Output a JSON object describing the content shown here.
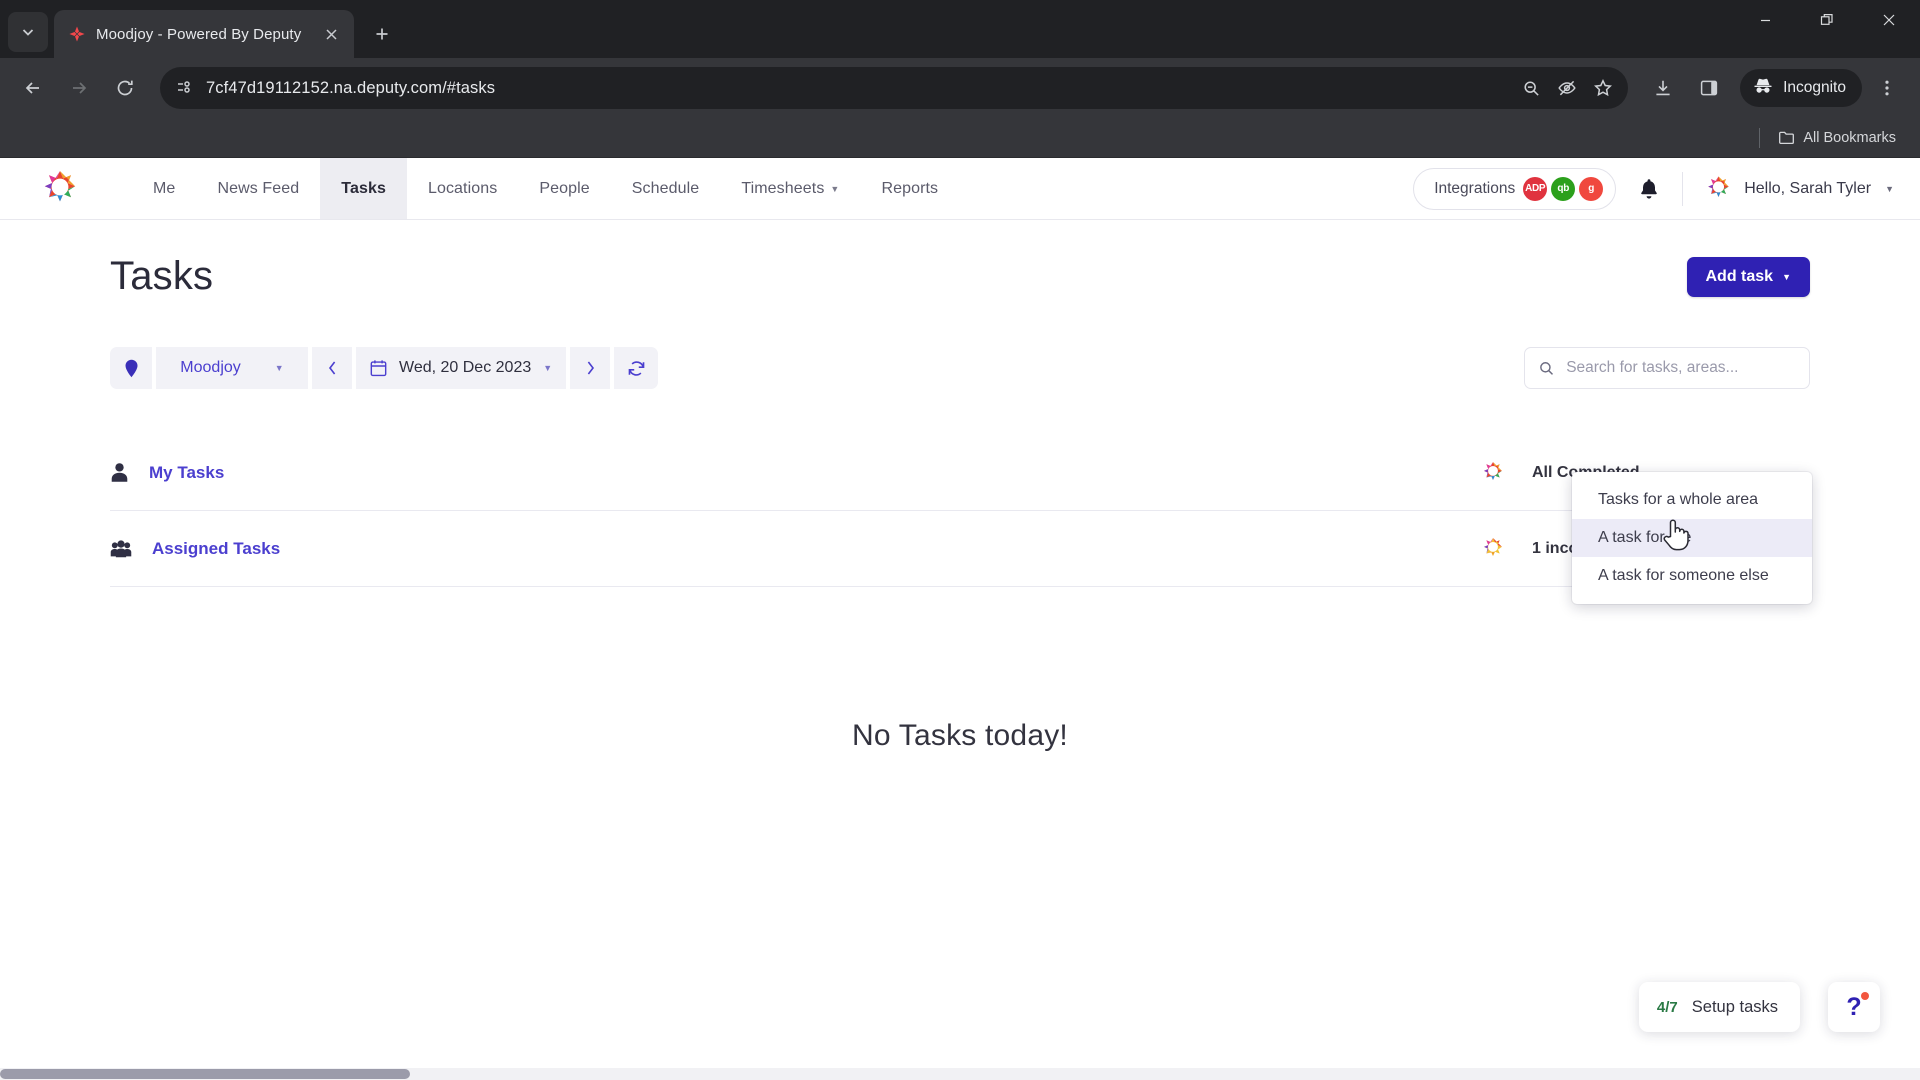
{
  "browser": {
    "tab": {
      "title": "Moodjoy - Powered By Deputy",
      "favicon_icon": "deputy-favicon",
      "close_icon": "close-icon",
      "tab_search_icon": "tab-search-chevron-icon",
      "new_tab_icon": "new-tab-plus-icon"
    },
    "window_controls": {
      "minimize_icon": "minimize-icon",
      "restore_icon": "restore-icon",
      "close_icon": "window-close-icon"
    },
    "toolbar": {
      "back_icon": "back-arrow-icon",
      "forward_icon": "forward-arrow-icon",
      "reload_icon": "reload-icon",
      "site_info_icon": "site-settings-icon",
      "url": "7cf47d19112152.na.deputy.com/#tasks",
      "zoom_out_icon": "zoom-out-icon",
      "hide_password_icon": "eye-slash-icon",
      "bookmark_icon": "star-icon",
      "download_icon": "download-icon",
      "side_panel_icon": "side-panel-icon",
      "incognito_label": "Incognito",
      "incognito_icon": "incognito-hat-icon",
      "menu_icon": "three-dot-menu-icon"
    },
    "bookmarks_bar": {
      "all_bookmarks_label": "All Bookmarks",
      "folder_icon": "folder-icon"
    }
  },
  "app": {
    "logo_icon": "deputy-star-logo",
    "nav": [
      {
        "label": "Me",
        "active": false,
        "caret": false
      },
      {
        "label": "News Feed",
        "active": false,
        "caret": false
      },
      {
        "label": "Tasks",
        "active": true,
        "caret": false
      },
      {
        "label": "Locations",
        "active": false,
        "caret": false
      },
      {
        "label": "People",
        "active": false,
        "caret": false
      },
      {
        "label": "Schedule",
        "active": false,
        "caret": false
      },
      {
        "label": "Timesheets",
        "active": false,
        "caret": true
      },
      {
        "label": "Reports",
        "active": false,
        "caret": false
      }
    ],
    "integrations": {
      "label": "Integrations",
      "badges": [
        {
          "name": "adp",
          "text": "ADP",
          "color": "#e0333f"
        },
        {
          "name": "quickbooks",
          "text": "qb",
          "color": "#2ca01c"
        },
        {
          "name": "gusto",
          "text": "g",
          "color": "#f0483e"
        }
      ]
    },
    "notifications_icon": "bell-icon",
    "avatar_icon": "user-avatar-star",
    "user_greeting": "Hello, Sarah Tyler",
    "user_caret_icon": "chevron-down-icon"
  },
  "page": {
    "title": "Tasks",
    "add_task": {
      "label": "Add task",
      "caret_icon": "chevron-down-icon",
      "color": "#2f21b3",
      "menu": [
        {
          "label": "Tasks for a whole area",
          "hover": false
        },
        {
          "label": "A task for me",
          "hover": true
        },
        {
          "label": "A task for someone else",
          "hover": false
        }
      ]
    },
    "filters": {
      "location_pin_icon": "location-pin-icon",
      "location": "Moodjoy",
      "location_caret_icon": "caret-down-icon",
      "prev_icon": "chevron-left-icon",
      "calendar_icon": "calendar-icon",
      "date": "Wed, 20 Dec 2023",
      "date_caret_icon": "caret-down-icon",
      "next_icon": "chevron-right-icon",
      "refresh_icon": "refresh-icon"
    },
    "search": {
      "icon": "search-icon",
      "placeholder": "Search for tasks, areas...",
      "value": ""
    },
    "task_groups": [
      {
        "label": "My Tasks",
        "icon": "single-person-icon",
        "status": "All Completed",
        "status_icon": "progress-ring-complete"
      },
      {
        "label": "Assigned Tasks",
        "icon": "group-people-icon",
        "status": "1 incomplete",
        "status_icon": "progress-ring-partial"
      }
    ],
    "empty_state": "No Tasks today!",
    "setup_widget": {
      "count": "4/7",
      "label": "Setup tasks"
    },
    "help_widget": {
      "glyph": "?",
      "icon": "help-question-icon",
      "badge_color": "#f2563f"
    }
  }
}
